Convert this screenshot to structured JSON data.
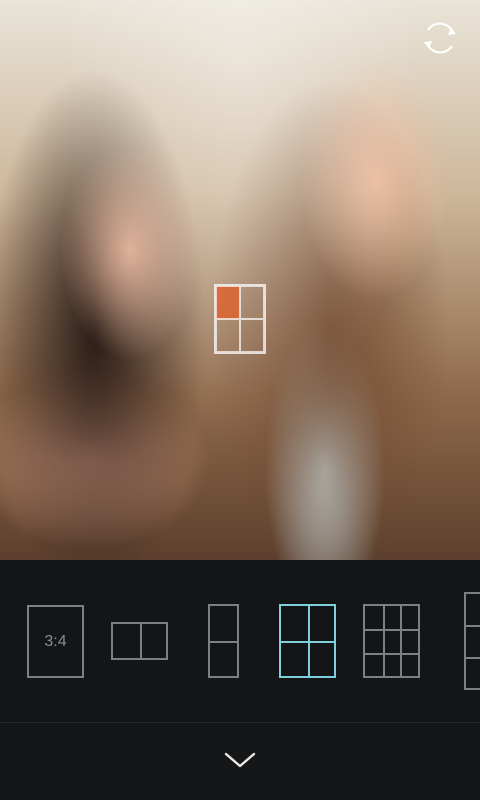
{
  "camera": {
    "ratio_label": "3:4",
    "selected_layout": "grid-2x2",
    "layouts": [
      "single-3:4",
      "split-2-horizontal",
      "split-2-vertical",
      "grid-2x2",
      "grid-3x3",
      "grid-1x3"
    ]
  },
  "icons": {
    "rotate": "rotate-camera-icon",
    "collapse": "chevron-down-icon"
  },
  "colors": {
    "accent": "#7fcfdc",
    "inactive": "#7d7f82",
    "toolbar_bg": "#131517",
    "focus_cell": "#dc6432"
  }
}
